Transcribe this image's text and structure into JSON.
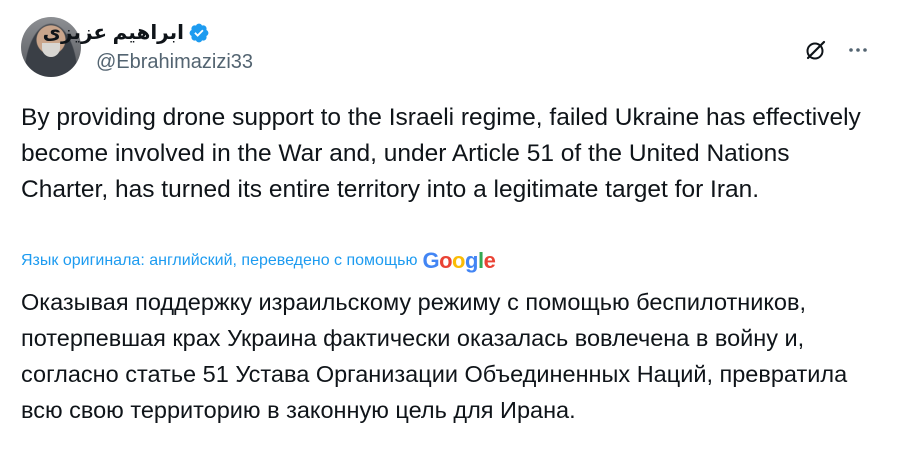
{
  "author": {
    "display_name": "ابراهیم عزیزی",
    "handle": "@Ebrahimazizi33"
  },
  "icons": {
    "verified": "verified-badge-icon",
    "grok": "grok-icon",
    "more": "more-options-icon"
  },
  "colors": {
    "accent": "#1d9bf0",
    "secondary_text": "#536471",
    "text": "#0f1419"
  },
  "tweet": {
    "text": "By providing drone support to the Israeli regime, failed Ukraine has effectively become involved in the War and, under Article 51 of the United Nations Charter, has turned its entire territory into a legitimate target for Iran.",
    "translation_label": "Язык оригинала: английский, переведено с помощью",
    "translation_provider": "Google",
    "translated_text": "Оказывая поддержку израильскому режиму с помощью беспилотников, потерпевшая крах Украина фактически оказалась вовлечена в войну и, согласно статье 51 Устава Организации Объединенных Наций, превратила всю свою территорию в законную цель для Ирана."
  }
}
